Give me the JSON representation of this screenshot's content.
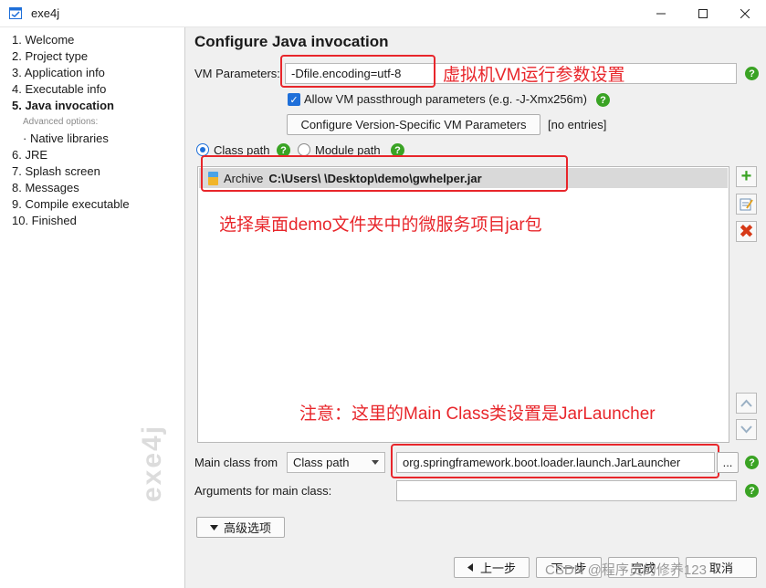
{
  "window": {
    "title": "exe4j",
    "watermark": "exe4j"
  },
  "sidebar": {
    "steps": [
      {
        "label": "1. Welcome"
      },
      {
        "label": "2. Project type"
      },
      {
        "label": "3. Application info"
      },
      {
        "label": "4. Executable info"
      },
      {
        "label": "5. Java invocation"
      },
      {
        "label": "Advanced options:"
      },
      {
        "label": "·  Native libraries"
      },
      {
        "label": "6. JRE"
      },
      {
        "label": "7. Splash screen"
      },
      {
        "label": "8. Messages"
      },
      {
        "label": "9. Compile executable"
      },
      {
        "label": "10. Finished"
      }
    ]
  },
  "main": {
    "title": "Configure Java invocation",
    "vm_params_label": "VM Parameters:",
    "vm_params_value": "-Dfile.encoding=utf-8",
    "allow_vm_label": "Allow VM passthrough parameters (e.g. -J-Xmx256m)",
    "version_specific_button": "Configure Version-Specific VM Parameters",
    "no_entries": "[no entries]",
    "class_path_label": "Class path",
    "module_path_label": "Module path",
    "archive_prefix": "Archive",
    "archive_path": "C:\\Users\\  \\Desktop\\demo\\gwhelper.jar",
    "main_class_label": "Main class from",
    "main_class_source": "Class path",
    "main_class_value": "org.springframework.boot.loader.launch.JarLauncher",
    "browse_button": "...",
    "args_label": "Arguments for main class:",
    "args_value": "",
    "advanced_button": "高级选项",
    "back_button": "上一步",
    "next_button": "下一步",
    "finish_button": "完成",
    "cancel_button": "取消",
    "csdn_watermark": "CSDN @程序员的修养123"
  },
  "annotations": {
    "vm": "虚拟机VM运行参数设置",
    "jar": "选择桌面demo文件夹中的微服务项目jar包",
    "main_class": "注意：这里的Main Class类设置是JarLauncher"
  },
  "colors": {
    "annotation": "#e8262b",
    "help": "#3aa324",
    "accent": "#1e6fd9"
  }
}
